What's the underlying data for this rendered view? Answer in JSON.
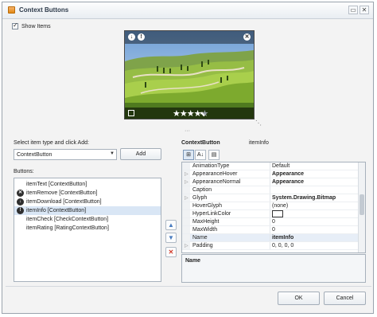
{
  "window": {
    "title": "Context Buttons",
    "minimize_glyph": "▭",
    "close_glyph": "✕"
  },
  "show_items": {
    "label": "Show Items",
    "checked": true
  },
  "preview": {
    "top_left_icons": [
      "download-icon",
      "info-icon"
    ],
    "top_right_icon": "close-icon",
    "rating_value": 4,
    "rating_max": 5,
    "star_glyph": "★",
    "bottom_check_checked": false,
    "collapse_glyph": "···",
    "resize_glyph": "⋱"
  },
  "add_section": {
    "label": "Select item type and click Add:",
    "combo_value": "ContextButton",
    "combo_arrow": "▼",
    "add_button": "Add"
  },
  "buttons_list": {
    "label": "Buttons:",
    "items": [
      {
        "text": "itemText [ContextButton]",
        "icon": "",
        "icon_name": "",
        "selected": false
      },
      {
        "text": "itemRemove [ContextButton]",
        "icon": "✕",
        "icon_name": "remove-icon",
        "selected": false
      },
      {
        "text": "itemDownload [ContextButton]",
        "icon": "↓",
        "icon_name": "download-icon",
        "selected": false
      },
      {
        "text": "itemInfo [ContextButton]",
        "icon": "!",
        "icon_name": "info-icon",
        "selected": true
      },
      {
        "text": "itemCheck [CheckContextButton]",
        "icon": "",
        "icon_name": "",
        "selected": false
      },
      {
        "text": "itemRating [RatingContextButton]",
        "icon": "",
        "icon_name": "",
        "selected": false
      }
    ]
  },
  "list_actions": {
    "up": "▲",
    "down": "▼",
    "remove": "✕"
  },
  "property_grid": {
    "object_type": "ContextButton",
    "object_name": "itemInfo",
    "tools": [
      "⊞",
      "A↓",
      "▤"
    ],
    "rows": [
      {
        "name": "AnimationType",
        "value": "Default",
        "expandable": false,
        "bold": false,
        "swatch": false
      },
      {
        "name": "AppearanceHover",
        "value": "Appearance",
        "expandable": true,
        "bold": true,
        "swatch": false
      },
      {
        "name": "AppearanceNormal",
        "value": "Appearance",
        "expandable": true,
        "bold": true,
        "swatch": false
      },
      {
        "name": "Caption",
        "value": "",
        "expandable": false,
        "bold": false,
        "swatch": false
      },
      {
        "name": "Glyph",
        "value": "System.Drawing.Bitmap",
        "expandable": true,
        "bold": true,
        "swatch": false
      },
      {
        "name": "HoverGlyph",
        "value": "(none)",
        "expandable": false,
        "bold": false,
        "swatch": false
      },
      {
        "name": "HyperLinkColor",
        "value": "",
        "expandable": false,
        "bold": false,
        "swatch": true
      },
      {
        "name": "MaxHeight",
        "value": "0",
        "expandable": false,
        "bold": false,
        "swatch": false
      },
      {
        "name": "MaxWidth",
        "value": "0",
        "expandable": false,
        "bold": false,
        "swatch": false
      },
      {
        "name": "Name",
        "value": "itemInfo",
        "expandable": false,
        "bold": true,
        "swatch": false
      },
      {
        "name": "Padding",
        "value": "0, 0, 0, 0",
        "expandable": true,
        "bold": false,
        "swatch": false
      }
    ],
    "description_title": "Name"
  },
  "footer": {
    "ok": "OK",
    "cancel": "Cancel"
  }
}
